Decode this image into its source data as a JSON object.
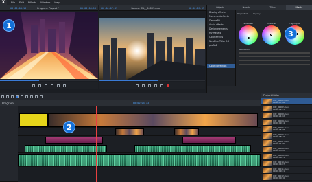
{
  "app": {
    "logo": "X"
  },
  "menu": [
    "File",
    "Edit",
    "Effects",
    "Window",
    "Help"
  ],
  "program_monitor": {
    "title": "Program: Project *",
    "timecode": "00:00:04:13"
  },
  "source_monitor": {
    "title": "Source: City_00001.mov",
    "timecode": "00:00:07:09"
  },
  "effects": {
    "tabs": [
      "Objects",
      "Presets",
      "Titles",
      "Effects"
    ],
    "active_tab": "Effects",
    "list": [
      "Display effects",
      "Movement effects",
      "Decore3D",
      "Audio effects",
      "Design elements",
      "My Presets",
      "Color effects",
      "NewBlue Titler 3.5",
      "proDAD"
    ],
    "selected": "Color correction",
    "extra_item": "Color correction"
  },
  "color": {
    "labels": [
      "Shadows",
      "Midtones",
      "Highlights"
    ],
    "options": [
      "Ungraded",
      "Legacy"
    ],
    "value_label": "Saturation"
  },
  "timeline": {
    "label": "Program",
    "timecode": "00:00:04:13"
  },
  "bin": {
    "title": "Project folder",
    "items": [
      {
        "name": "City_00001.mov",
        "info": "00:00:17:06"
      },
      {
        "name": "City_00002.mov",
        "info": "00:00:12:23"
      },
      {
        "name": "City_00003.mov",
        "info": "00:00:21:02"
      },
      {
        "name": "City_00004.mov",
        "info": "00:00:09:14"
      },
      {
        "name": "City_00005.mov",
        "info": "00:00:15:08"
      },
      {
        "name": "City_00006.mov",
        "info": "00:00:18:19"
      },
      {
        "name": "City_00007.mov",
        "info": "00:00:11:05"
      },
      {
        "name": "City_00008.mov",
        "info": "00:00:13:02"
      },
      {
        "name": "City_00009.mov",
        "info": "00:00:16:11"
      },
      {
        "name": "City_00010.mov",
        "info": "00:00:14:07"
      },
      {
        "name": "City_00011.mov",
        "info": "00:00:19:21"
      },
      {
        "name": "City_00012.mov",
        "info": "00:00:10:16"
      }
    ]
  },
  "badges": [
    "1",
    "2",
    "3"
  ]
}
